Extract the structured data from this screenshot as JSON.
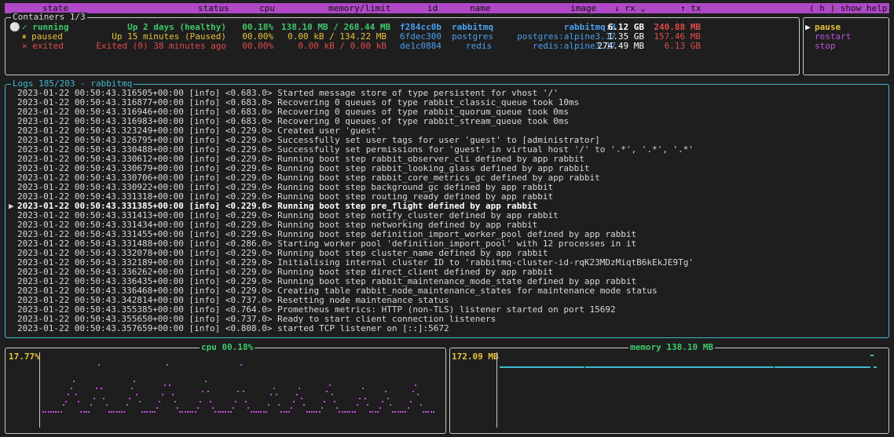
{
  "header": {
    "columns": {
      "state": "state",
      "status": "status",
      "cpu": "cpu",
      "memory": "memory/limit",
      "id": "id",
      "name": "name",
      "image": "image",
      "rx": "↓ rx ⌄",
      "tx": "↑ tx"
    },
    "help": "( h ) show help"
  },
  "containers": {
    "title": "Containers 1/3",
    "rows": [
      {
        "marker": "⚪",
        "state": "✓ running",
        "status": "Up 2 days (healthy)",
        "cpu": "00.18%",
        "memory": "138.10 MB / 268.44 MB",
        "id": "f284cc0b",
        "name": "rabbitmq",
        "image": "rabbitmq:3",
        "rx": "6.12 GB",
        "tx": "240.88 MB"
      },
      {
        "marker": "",
        "state": "⏸ paused",
        "status": "Up 15 minutes (Paused)",
        "cpu": "00.00%",
        "memory": "0.00 kB / 134.22 MB",
        "id": "6fdec300",
        "name": "postgres",
        "image": "postgres:alpine3.17",
        "rx": "1.35 GB",
        "tx": "157.46 MB"
      },
      {
        "marker": "",
        "state": "✕ exited",
        "status": "Exited (0) 38 minutes ago",
        "cpu": "00.00%",
        "memory": "0.00 kB / 0.00 kB",
        "id": "de1c0884",
        "name": "redis",
        "image": "redis:alpine3.17",
        "rx": "274.49 MB",
        "tx": "6.13 GB"
      }
    ]
  },
  "commands": {
    "cursor": "▶",
    "items": [
      "pause",
      "restart",
      "stop"
    ]
  },
  "logs": {
    "title": "Logs 185/203 - rabbitmq",
    "cursor": "▶",
    "lines": [
      "2023-01-22 00:50:43.316505+00:00 [info] <0.683.0> Started message store of type persistent for vhost '/'",
      "2023-01-22 00:50:43.316877+00:00 [info] <0.683.0> Recovering 0 queues of type rabbit_classic_queue took 10ms",
      "2023-01-22 00:50:43.316946+00:00 [info] <0.683.0> Recovering 0 queues of type rabbit_quorum_queue took 0ms",
      "2023-01-22 00:50:43.316983+00:00 [info] <0.683.0> Recovering 0 queues of type rabbit_stream_queue took 0ms",
      "2023-01-22 00:50:43.323249+00:00 [info] <0.229.0> Created user 'guest'",
      "2023-01-22 00:50:43.326795+00:00 [info] <0.229.0> Successfully set user tags for user 'guest' to [administrator]",
      "2023-01-22 00:50:43.330488+00:00 [info] <0.229.0> Successfully set permissions for 'guest' in virtual host '/' to '.*', '.*', '.*'",
      "2023-01-22 00:50:43.330612+00:00 [info] <0.229.0> Running boot step rabbit_observer_cli defined by app rabbit",
      "2023-01-22 00:50:43.330679+00:00 [info] <0.229.0> Running boot step rabbit_looking_glass defined by app rabbit",
      "2023-01-22 00:50:43.330706+00:00 [info] <0.229.0> Running boot step rabbit_core_metrics_gc defined by app rabbit",
      "2023-01-22 00:50:43.330922+00:00 [info] <0.229.0> Running boot step background_gc defined by app rabbit",
      "2023-01-22 00:50:43.331318+00:00 [info] <0.229.0> Running boot step routing_ready defined by app rabbit",
      "2023-01-22 00:50:43.331385+00:00 [info] <0.229.0> Running boot step pre_flight defined by app rabbit",
      "2023-01-22 00:50:43.331413+00:00 [info] <0.229.0> Running boot step notify_cluster defined by app rabbit",
      "2023-01-22 00:50:43.331434+00:00 [info] <0.229.0> Running boot step networking defined by app rabbit",
      "2023-01-22 00:50:43.331455+00:00 [info] <0.229.0> Running boot step definition_import_worker_pool defined by app rabbit",
      "2023-01-22 00:50:43.331488+00:00 [info] <0.286.0> Starting worker pool 'definition_import_pool' with 12 processes in it",
      "2023-01-22 00:50:43.332078+00:00 [info] <0.229.0> Running boot step cluster_name defined by app rabbit",
      "2023-01-22 00:50:43.332189+00:00 [info] <0.229.0> Initialising internal cluster ID to 'rabbitmq-cluster-id-rqK23MDzMiqtB6kEkJE9Tg'",
      "2023-01-22 00:50:43.336262+00:00 [info] <0.229.0> Running boot step direct_client defined by app rabbit",
      "2023-01-22 00:50:43.336435+00:00 [info] <0.229.0> Running boot step rabbit_maintenance_mode_state defined by app rabbit",
      "2023-01-22 00:50:43.336468+00:00 [info] <0.229.0> Creating table rabbit_node_maintenance_states for maintenance mode status",
      "2023-01-22 00:50:43.342814+00:00 [info] <0.737.0> Resetting node maintenance status",
      "2023-01-22 00:50:43.355385+00:00 [info] <0.764.0> Prometheus metrics: HTTP (non-TLS) listener started on port 15692",
      "2023-01-22 00:50:43.355650+00:00 [info] <0.737.0> Ready to start client connection listeners",
      "2023-01-22 00:50:43.357659+00:00 [info] <0.808.0> started TCP listener on [::]:5672"
    ],
    "selected_index": 12
  },
  "cpu_chart": {
    "title": "cpu 00.18%",
    "max_label": "17.77%",
    "color": "#c050d8"
  },
  "memory_chart": {
    "title": "memory 138.10 MB",
    "max_label": "172.09 MB",
    "color": "#40b8d0"
  },
  "chart_data": [
    {
      "type": "scatter",
      "title": "cpu 00.18%",
      "ylabel": "17.77%",
      "ylim": [
        0,
        17.77
      ],
      "values": [
        1,
        1,
        1,
        1,
        1,
        1,
        1,
        1,
        3,
        4,
        6,
        8,
        10,
        6,
        4,
        1,
        1,
        1,
        1,
        3,
        5,
        8,
        15,
        8,
        5,
        3,
        1,
        1,
        1,
        1,
        1,
        1,
        1,
        3,
        5,
        8,
        10,
        6,
        4,
        1,
        1,
        1,
        1,
        1,
        1,
        2,
        4,
        6,
        9,
        15,
        9,
        6,
        4,
        2,
        1,
        1,
        1,
        1,
        1,
        1,
        1,
        2,
        4,
        7,
        10,
        7,
        4,
        2,
        1,
        1,
        1,
        1,
        1,
        1,
        1,
        2,
        4,
        7,
        15,
        7,
        4,
        2,
        1,
        1,
        1,
        1,
        1,
        1,
        1,
        3,
        6,
        8,
        6,
        3,
        1,
        1,
        1,
        1,
        2,
        4,
        6,
        8,
        5,
        3,
        1,
        1,
        1,
        1,
        1,
        1,
        2,
        4,
        7,
        9,
        6,
        4,
        2,
        1,
        1,
        1,
        1,
        1,
        1,
        1,
        3,
        5,
        8,
        5,
        3,
        1,
        1,
        1,
        1,
        2,
        4,
        7,
        5,
        3,
        1,
        1,
        1,
        1,
        1,
        1,
        2,
        4,
        7,
        9,
        6,
        3,
        1,
        1,
        1,
        1,
        1
      ]
    },
    {
      "type": "line",
      "title": "memory 138.10 MB",
      "ylabel": "172.09 MB",
      "ylim": [
        0,
        172.09
      ],
      "values": [
        138.1,
        138.1,
        138.1,
        138.1,
        138.1,
        138.1,
        138.1,
        138.1,
        138.1,
        138.1,
        138.1,
        138.1,
        138.1,
        138.1,
        138.1,
        138.1,
        138.1,
        138.1,
        138.1,
        138.1,
        138.1,
        138.1,
        138.1,
        138.1,
        138.1,
        138.1,
        138.1,
        138.1,
        138.1,
        138.1,
        138.1,
        138.1,
        138.1,
        138.1,
        138.1,
        138.1,
        138.1,
        138.1,
        138.1,
        138.1,
        138.1,
        138.1,
        138.1,
        138.1,
        138.1,
        138.1,
        138.1,
        138.1,
        138.1,
        138.1,
        138.1,
        138.1,
        138.1,
        138.1,
        138.1,
        138.1,
        138.1,
        138.1,
        138.1,
        138.1,
        138.1,
        138.1,
        138.1,
        138.1,
        138.1,
        138.1,
        138.1,
        138.1,
        138.1,
        138.1,
        138.1,
        138.1,
        138.1,
        138.1,
        138.1,
        138.1,
        138.1,
        138.1,
        138.1,
        138.1,
        138.1,
        138.1,
        138.1,
        138.1,
        138.1,
        138.1,
        138.1,
        138.1,
        138.1,
        138.1,
        138.1,
        138.1,
        138.1,
        138.1,
        138.1,
        138.1,
        138.1,
        138.1,
        138.1,
        138.1,
        138.1,
        138.1,
        138.1,
        138.1,
        138.1,
        138.1,
        138.1,
        138.1,
        138.1,
        138.1,
        138.1,
        138.1,
        138.1,
        138.1,
        138.1,
        138.1,
        138.1,
        138.1,
        138.1,
        138.1,
        138.1,
        138.1,
        138.1,
        138.1,
        138.1,
        138.1,
        138.1,
        138.1,
        138.1,
        138.1,
        138.1,
        138.1,
        138.1,
        138.1,
        138.1,
        138.1,
        138.1,
        138.1,
        138.1,
        138.1,
        138.1,
        138.1,
        138.1,
        138.1,
        138.1,
        138.1,
        138.1,
        138.1,
        138.1,
        138.1,
        138.1,
        138.1,
        138.1,
        138.1,
        138.1,
        138.1,
        138.1,
        138.1,
        138.1,
        138.1,
        138.1,
        138.1,
        138.1,
        138.1,
        138.1,
        138.1,
        138.1,
        138.1,
        138.1,
        138.1,
        138.1,
        138.1,
        138.1,
        138.1,
        138.1,
        138.1,
        138.1,
        138.1,
        138.1,
        138.1,
        138.1,
        138.1,
        138.1,
        138.1,
        138.1,
        138.1,
        138.1,
        138.1,
        138.1,
        138.1,
        138.1,
        138.1,
        138.1,
        138.1,
        138.1,
        138.1,
        138.1,
        138.1,
        138.1,
        138.1,
        138.1,
        138.1,
        138.1,
        138.1,
        138.1,
        138.1,
        138.1,
        138.1,
        138.1,
        138.1,
        138.1,
        138.1,
        138.1,
        138.1,
        138.1,
        138.1,
        138.1,
        138.1,
        138.1,
        138.1,
        138.1,
        138.1,
        138.1,
        138.1,
        138.1,
        138.1,
        138.1,
        138.1,
        138.1,
        138.1,
        138.1,
        138.1,
        138.1,
        138.1,
        138.1,
        172.09,
        172.09,
        138.1,
        138.1
      ]
    }
  ]
}
